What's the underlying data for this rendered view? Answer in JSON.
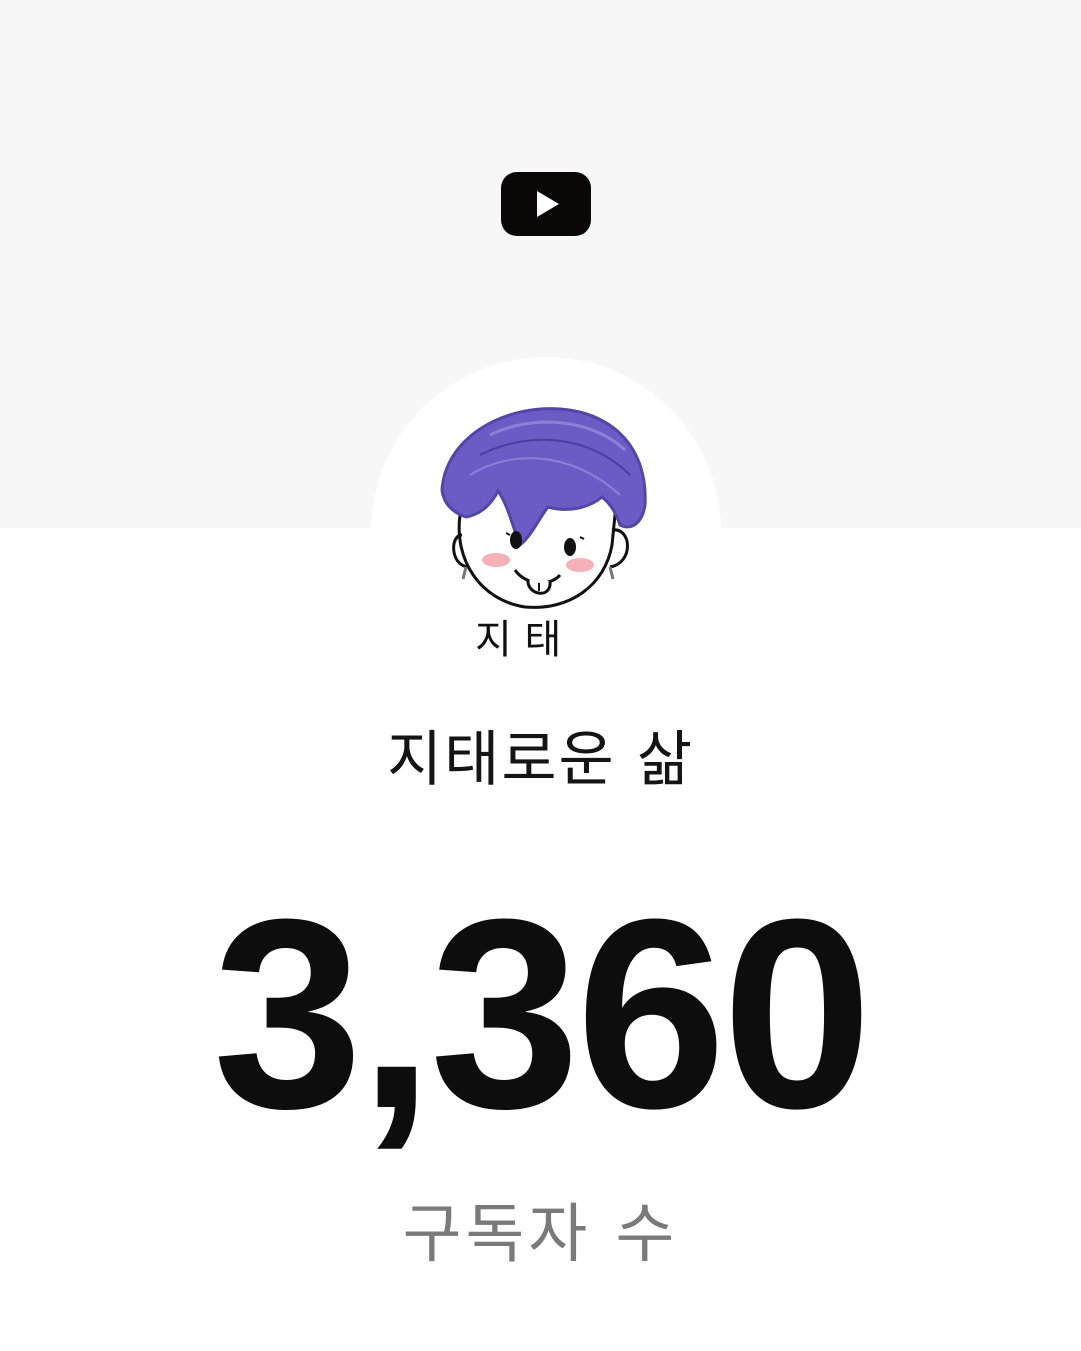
{
  "header": {
    "platform_icon": "youtube-play-icon"
  },
  "profile": {
    "avatar_icon": "cartoon-avatar",
    "avatar_text": "지 태",
    "channel_name": "지태로운 삶"
  },
  "stats": {
    "subscriber_count": "3,360",
    "subscriber_label": "구독자 수"
  },
  "colors": {
    "banner_bg": "#f7f7f7",
    "hair": "#6a5cc4",
    "text_primary": "#141414",
    "text_secondary": "#7a7a7a"
  }
}
